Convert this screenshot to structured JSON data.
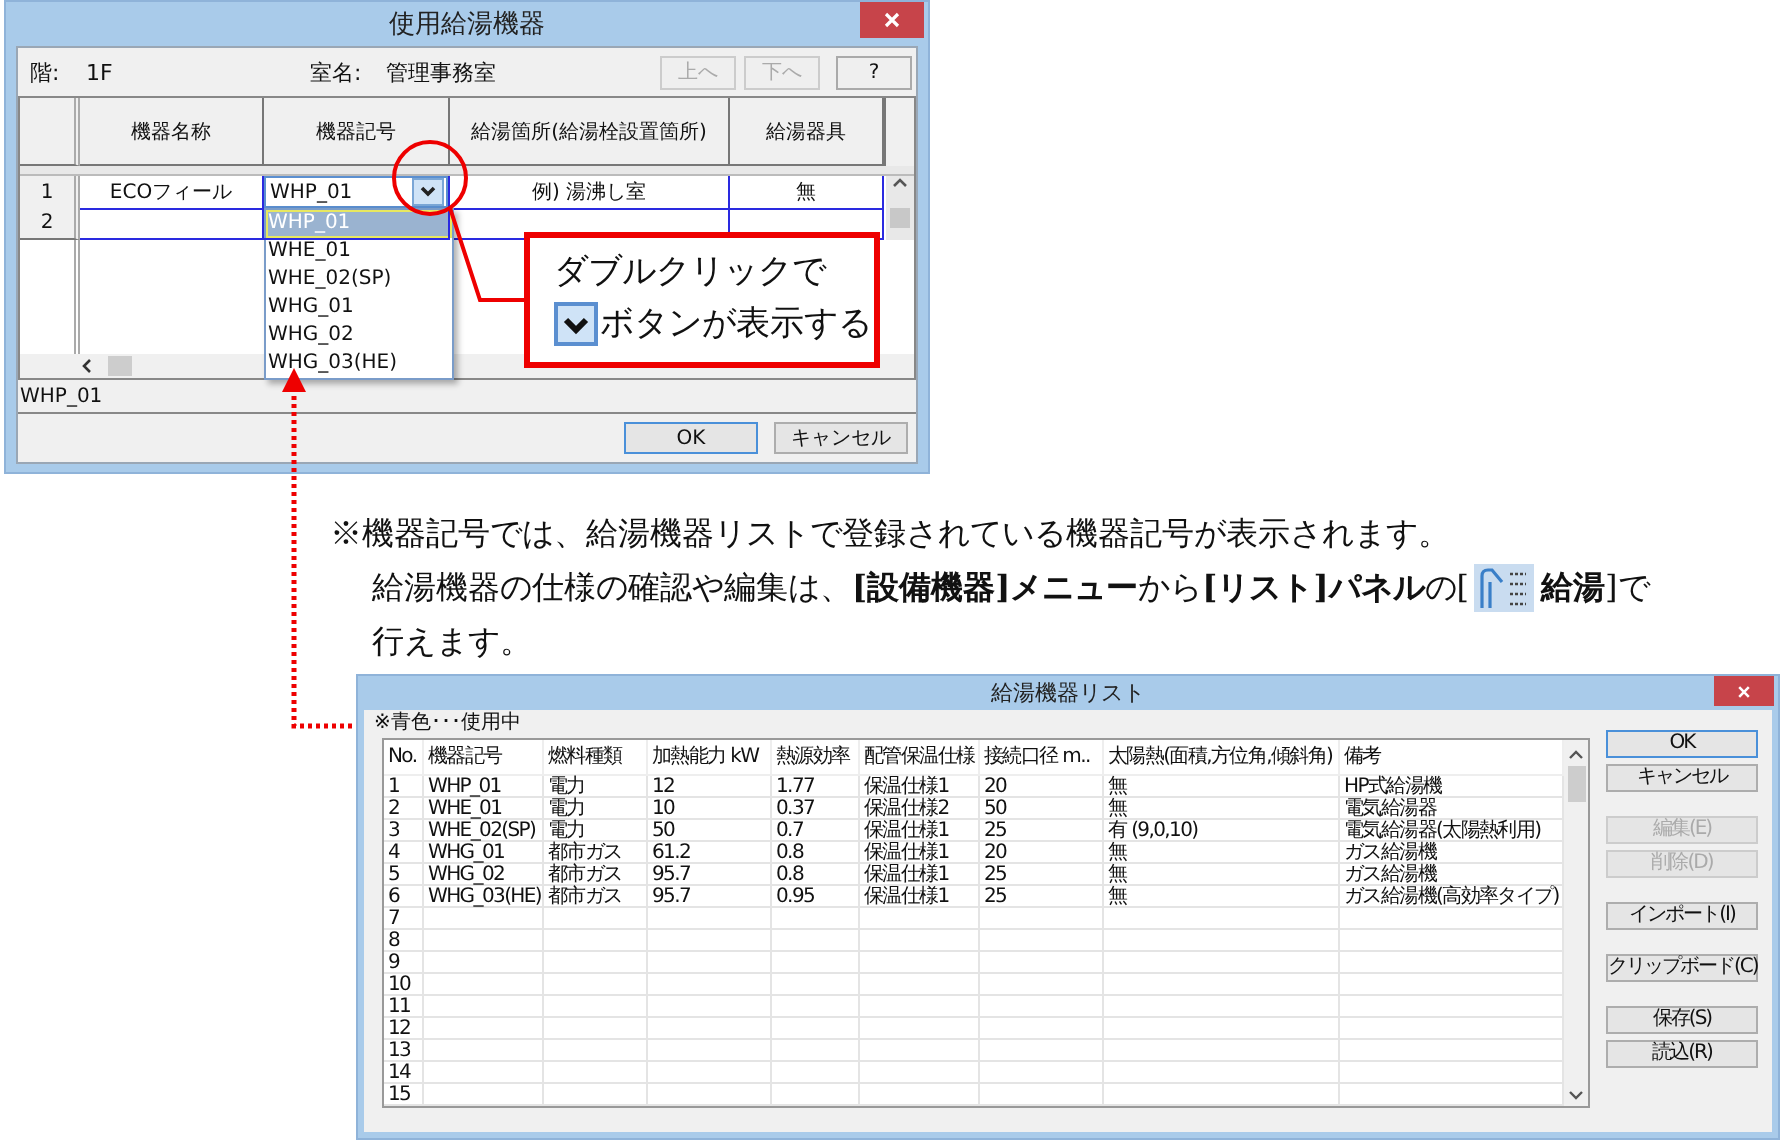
{
  "dialog": {
    "title": "使用給湯機器",
    "floor_label": "階:",
    "floor": "1F",
    "room_label": "室名:",
    "room": "管理事務室",
    "nav_buttons": [
      {
        "label": "上へ",
        "disabled": true
      },
      {
        "label": "下へ",
        "disabled": true
      },
      {
        "label": "?",
        "disabled": false
      }
    ],
    "columns": [
      "機器名称",
      "機器記号",
      "給湯箇所(給湯栓設置箇所)",
      "給湯器具"
    ],
    "rows": [
      {
        "no": "1",
        "name": "ECOフィール",
        "code": "WHP_01",
        "location": "例) 湯沸し室",
        "fixture": "無",
        "editing": true
      },
      {
        "no": "2",
        "editing": false
      }
    ],
    "dropdown_options": [
      {
        "label": "WHP_01",
        "selected": true
      },
      {
        "label": "WHE_01",
        "selected": false
      },
      {
        "label": "WHE_02(SP)",
        "selected": false
      },
      {
        "label": "WHG_01",
        "selected": false
      },
      {
        "label": "WHG_02",
        "selected": false
      },
      {
        "label": "WHG_03(HE)",
        "selected": false
      }
    ],
    "status": "WHP_01",
    "buttons": [
      "OK",
      "キャンセル"
    ]
  },
  "callout": {
    "line1": "ダブルクリックで",
    "line2": "ボタンが表示する"
  },
  "note": {
    "line1": "※機器記号では、給湯機器リストで登録されている機器記号が表示されます。",
    "line2_start": "給湯機器の仕様の確認や編集は、**[設備機器]メニュー**から**[リスト]パネル**の[",
    "line2_end": "**給湯**]で",
    "line3": "行えます。"
  },
  "list_dialog": {
    "title": "給湯機器リスト",
    "caption": "※青色･･･使用中",
    "columns": [
      "No.",
      "機器記号",
      "燃料種類",
      "加熱能力 kW",
      "熱源効率",
      "配管保温仕様",
      "接続口径 m..",
      "太陽熱(面積,方位角,傾斜角)",
      "備考"
    ],
    "rows": [
      {
        "no": "1",
        "cells": [
          "WHP_01",
          "電力",
          "12",
          "1.77",
          "保温仕様1",
          "20",
          "無",
          "HP式給湯機"
        ]
      },
      {
        "no": "2",
        "cells": [
          "WHE_01",
          "電力",
          "10",
          "0.37",
          "保温仕様2",
          "50",
          "無",
          "電気給湯器"
        ]
      },
      {
        "no": "3",
        "cells": [
          "WHE_02(SP)",
          "電力",
          "50",
          "0.7",
          "保温仕様1",
          "25",
          "有 (9,0,10)",
          "電気給湯器(太陽熱利用)"
        ]
      },
      {
        "no": "4",
        "cells": [
          "WHG_01",
          "都市ガス",
          "61.2",
          "0.8",
          "保温仕様1",
          "20",
          "無",
          "ガス給湯機"
        ]
      },
      {
        "no": "5",
        "cells": [
          "WHG_02",
          "都市ガス",
          "95.7",
          "0.8",
          "保温仕様1",
          "25",
          "無",
          "ガス給湯機"
        ]
      },
      {
        "no": "6",
        "cells": [
          "WHG_03(HE)",
          "都市ガス",
          "95.7",
          "0.95",
          "保温仕様1",
          "25",
          "無",
          "ガス給湯機(高効率タイプ)"
        ]
      },
      {
        "no": "7"
      },
      {
        "no": "8"
      },
      {
        "no": "9"
      },
      {
        "no": "10"
      },
      {
        "no": "11"
      },
      {
        "no": "12"
      },
      {
        "no": "13"
      },
      {
        "no": "14"
      },
      {
        "no": "15"
      }
    ],
    "buttons": [
      {
        "label": "OK",
        "disabled": false
      },
      {
        "label": "キャンセル",
        "disabled": false
      },
      {
        "label": "編集(E)",
        "disabled": true
      },
      {
        "label": "削除(D)",
        "disabled": true
      },
      {
        "label": "インポート(I)",
        "disabled": false
      },
      {
        "label": "クリップボード(C)",
        "disabled": false
      },
      {
        "label": "保存(S)",
        "disabled": false
      },
      {
        "label": "読込(R)",
        "disabled": false
      }
    ]
  }
}
